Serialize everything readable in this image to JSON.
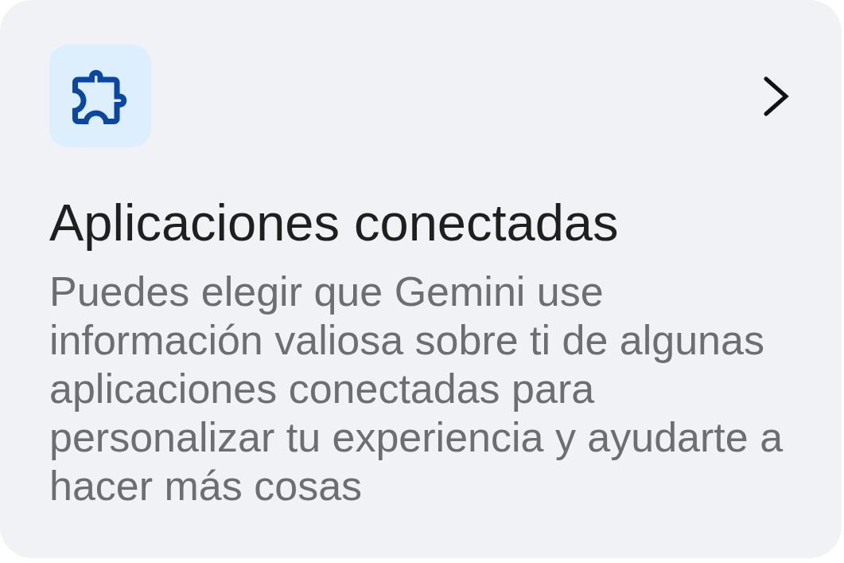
{
  "card": {
    "title": "Aplicaciones conectadas",
    "description": "Puedes elegir que Gemini use información valiosa sobre ti de algunas aplicaciones conectadas para personalizar tu experiencia y ayudarte a hacer más cosas"
  }
}
